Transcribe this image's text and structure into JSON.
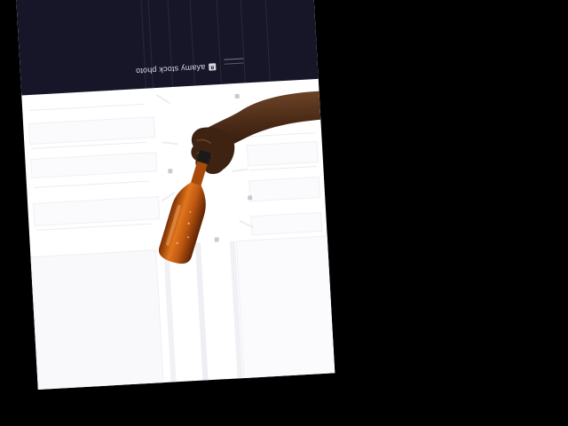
{
  "photo": {
    "watermark_text": "aʎamy stock photo",
    "watermark_logo": "a",
    "subject": "hand-holding-beer-bottle"
  },
  "colors": {
    "background": "#000000",
    "header_band": "#161628",
    "sheet": "#ffffff",
    "bottle": "#c25a12",
    "bottle_cap": "#1a1a1a",
    "skin": "#4a2a16"
  }
}
